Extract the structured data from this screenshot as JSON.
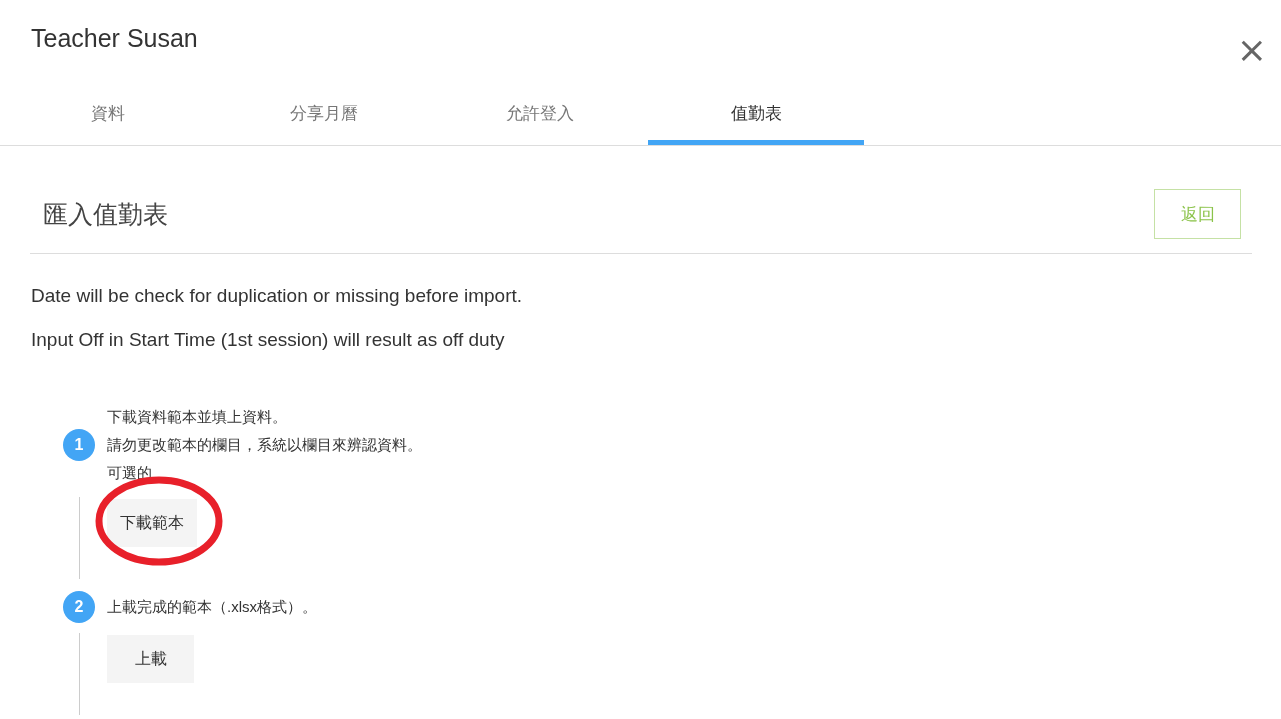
{
  "dialog": {
    "title": "Teacher Susan",
    "close": "×"
  },
  "tabs": [
    {
      "label": "資料",
      "selected": false
    },
    {
      "label": "分享月曆",
      "selected": false
    },
    {
      "label": "允許登入",
      "selected": false
    },
    {
      "label": "值勤表",
      "selected": true
    }
  ],
  "section": {
    "title": "匯入值勤表",
    "back_button": "返回"
  },
  "notes": [
    "Date will be check for duplication or missing before import.",
    "Input Off in Start Time (1st session) will result as off duty"
  ],
  "steps": [
    {
      "number": "1",
      "lines": [
        "下載資料範本並填上資料。",
        "請勿更改範本的欄目，系統以欄目來辨認資料。",
        "可選的"
      ],
      "button": "下載範本",
      "circled": true
    },
    {
      "number": "2",
      "lines": [
        "上載完成的範本（.xlsx格式）。"
      ],
      "button": "上載",
      "circled": false
    }
  ]
}
